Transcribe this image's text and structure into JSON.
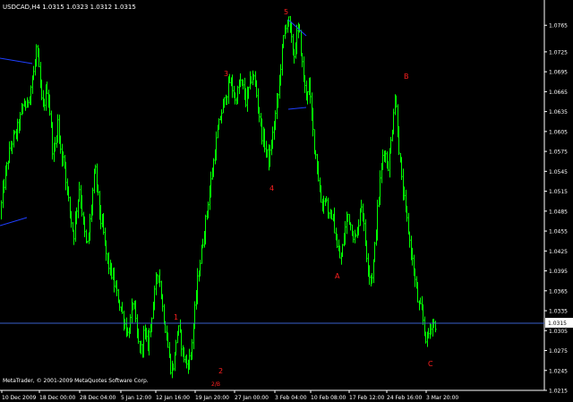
{
  "window": {
    "symbol_title": "USDCAD,H4  1.0315 1.0323 1.0312 1.0315",
    "copyright": "MetaTrader, © 2001-2009 MetaQuotes Software Corp."
  },
  "colors": {
    "background": "#000000",
    "candles": "#00ff00",
    "axis": "#ffffff",
    "annotations": "#ff0000",
    "trendlines": "#1f3fff",
    "price_line": "#3a5fcd",
    "current_price_box": "#ffffff"
  },
  "chart_data": {
    "type": "candlestick",
    "price_axis_ticks": [
      "1.0765",
      "1.0725",
      "1.0695",
      "1.0665",
      "1.0635",
      "1.0605",
      "1.0575",
      "1.0545",
      "1.0515",
      "1.0485",
      "1.0455",
      "1.0425",
      "1.0395",
      "1.0365",
      "1.0335",
      "1.0305",
      "1.0275",
      "1.0245",
      "1.0215"
    ],
    "time_axis_ticks": [
      "10 Dec 2009",
      "18 Dec 00:00",
      "28 Dec 04:00",
      "5 Jan 12:00",
      "12 Jan 16:00",
      "19 Jan 20:00",
      "27 Jan 00:00",
      "3 Feb 04:00",
      "10 Feb 08:00",
      "17 Feb 12:00",
      "24 Feb 16:00",
      "3 Mar 20:00"
    ],
    "current_price": "1.0315",
    "ylim": [
      1.0215,
      1.0795
    ],
    "wave_labels": [
      "1",
      "2",
      "2/B",
      "3",
      "4",
      "5",
      "A",
      "B",
      "C"
    ],
    "price_path": [
      [
        0,
        1.048
      ],
      [
        2,
        1.051
      ],
      [
        5,
        1.0535
      ],
      [
        8,
        1.056
      ],
      [
        11,
        1.058
      ],
      [
        14,
        1.0595
      ],
      [
        17,
        1.06
      ],
      [
        20,
        1.0615
      ],
      [
        23,
        1.063
      ],
      [
        26,
        1.065
      ],
      [
        29,
        1.064
      ],
      [
        32,
        1.066
      ],
      [
        35,
        1.068
      ],
      [
        38,
        1.07
      ],
      [
        40,
        1.073
      ],
      [
        42,
        1.071
      ],
      [
        44,
        1.068
      ],
      [
        46,
        1.065
      ],
      [
        48,
        1.064
      ],
      [
        50,
        1.066
      ],
      [
        52,
        1.067
      ],
      [
        54,
        1.065
      ],
      [
        56,
        1.062
      ],
      [
        58,
        1.058
      ],
      [
        60,
        1.057
      ],
      [
        62,
        1.06
      ],
      [
        64,
        1.062
      ],
      [
        66,
        1.059
      ],
      [
        68,
        1.056
      ],
      [
        70,
        1.057
      ],
      [
        72,
        1.055
      ],
      [
        74,
        1.052
      ],
      [
        76,
        1.05
      ],
      [
        78,
        1.048
      ],
      [
        80,
        1.046
      ],
      [
        82,
        1.045
      ],
      [
        84,
        1.048
      ],
      [
        86,
        1.05
      ],
      [
        88,
        1.052
      ],
      [
        90,
        1.05
      ],
      [
        92,
        1.047
      ],
      [
        94,
        1.045
      ],
      [
        96,
        1.043
      ],
      [
        98,
        1.044
      ],
      [
        100,
        1.047
      ],
      [
        102,
        1.05
      ],
      [
        104,
        1.053
      ],
      [
        106,
        1.0545
      ],
      [
        108,
        1.052
      ],
      [
        110,
        1.049
      ],
      [
        112,
        1.047
      ],
      [
        114,
        1.046
      ],
      [
        116,
        1.044
      ],
      [
        118,
        1.042
      ],
      [
        120,
        1.0405
      ],
      [
        122,
        1.04
      ],
      [
        124,
        1.039
      ],
      [
        126,
        1.038
      ],
      [
        128,
        1.037
      ],
      [
        130,
        1.036
      ],
      [
        132,
        1.035
      ],
      [
        134,
        1.034
      ],
      [
        136,
        1.033
      ],
      [
        138,
        1.032
      ],
      [
        140,
        1.031
      ],
      [
        142,
        1.03
      ],
      [
        144,
        1.031
      ],
      [
        146,
        1.033
      ],
      [
        148,
        1.035
      ],
      [
        150,
        1.033
      ],
      [
        152,
        1.03
      ],
      [
        154,
        1.0285
      ],
      [
        156,
        1.0275
      ],
      [
        158,
        1.028
      ],
      [
        160,
        1.03
      ],
      [
        162,
        1.0295
      ],
      [
        164,
        1.028
      ],
      [
        166,
        1.03
      ],
      [
        168,
        1.032
      ],
      [
        170,
        1.034
      ],
      [
        172,
        1.036
      ],
      [
        174,
        1.038
      ],
      [
        176,
        1.04
      ],
      [
        178,
        1.038
      ],
      [
        180,
        1.035
      ],
      [
        182,
        1.033
      ],
      [
        184,
        1.031
      ],
      [
        186,
        1.029
      ],
      [
        188,
        1.027
      ],
      [
        190,
        1.025
      ],
      [
        192,
        1.0245
      ],
      [
        194,
        1.026
      ],
      [
        196,
        1.029
      ],
      [
        198,
        1.031
      ],
      [
        200,
        1.03
      ],
      [
        202,
        1.0285
      ],
      [
        204,
        1.027
      ],
      [
        206,
        1.026
      ],
      [
        208,
        1.0255
      ],
      [
        210,
        1.026
      ],
      [
        212,
        1.0265
      ],
      [
        214,
        1.029
      ],
      [
        216,
        1.032
      ],
      [
        218,
        1.035
      ],
      [
        220,
        1.038
      ],
      [
        222,
        1.04
      ],
      [
        224,
        1.042
      ],
      [
        226,
        1.044
      ],
      [
        228,
        1.046
      ],
      [
        230,
        1.048
      ],
      [
        232,
        1.05
      ],
      [
        234,
        1.052
      ],
      [
        236,
        1.054
      ],
      [
        238,
        1.056
      ],
      [
        240,
        1.058
      ],
      [
        242,
        1.06
      ],
      [
        244,
        1.0615
      ],
      [
        246,
        1.063
      ],
      [
        248,
        1.064
      ],
      [
        250,
        1.065
      ],
      [
        252,
        1.066
      ],
      [
        254,
        1.067
      ],
      [
        256,
        1.068
      ],
      [
        258,
        1.0675
      ],
      [
        260,
        1.0665
      ],
      [
        262,
        1.065
      ],
      [
        264,
        1.066
      ],
      [
        266,
        1.067
      ],
      [
        268,
        1.068
      ],
      [
        270,
        1.0675
      ],
      [
        272,
        1.0665
      ],
      [
        274,
        1.065
      ],
      [
        276,
        1.066
      ],
      [
        278,
        1.0675
      ],
      [
        280,
        1.0685
      ],
      [
        282,
        1.069
      ],
      [
        284,
        1.068
      ],
      [
        286,
        1.066
      ],
      [
        288,
        1.064
      ],
      [
        290,
        1.062
      ],
      [
        292,
        1.06
      ],
      [
        294,
        1.059
      ],
      [
        296,
        1.058
      ],
      [
        298,
        1.057
      ],
      [
        300,
        1.056
      ],
      [
        302,
        1.058
      ],
      [
        304,
        1.06
      ],
      [
        306,
        1.062
      ],
      [
        308,
        1.064
      ],
      [
        310,
        1.066
      ],
      [
        312,
        1.069
      ],
      [
        314,
        1.072
      ],
      [
        316,
        1.0745
      ],
      [
        318,
        1.076
      ],
      [
        320,
        1.0775
      ],
      [
        322,
        1.077
      ],
      [
        324,
        1.075
      ],
      [
        326,
        1.073
      ],
      [
        328,
        1.072
      ],
      [
        330,
        1.074
      ],
      [
        332,
        1.076
      ],
      [
        334,
        1.075
      ],
      [
        336,
        1.072
      ],
      [
        338,
        1.069
      ],
      [
        340,
        1.067
      ],
      [
        342,
        1.066
      ],
      [
        344,
        1.068
      ],
      [
        346,
        1.065
      ],
      [
        348,
        1.062
      ],
      [
        350,
        1.059
      ],
      [
        352,
        1.057
      ],
      [
        354,
        1.055
      ],
      [
        356,
        1.052
      ],
      [
        358,
        1.05
      ],
      [
        360,
        1.049
      ],
      [
        362,
        1.051
      ],
      [
        364,
        1.05
      ],
      [
        366,
        1.048
      ],
      [
        368,
        1.047
      ],
      [
        370,
        1.048
      ],
      [
        372,
        1.047
      ],
      [
        374,
        1.045
      ],
      [
        376,
        1.043
      ],
      [
        378,
        1.042
      ],
      [
        380,
        1.041
      ],
      [
        382,
        1.043
      ],
      [
        384,
        1.045
      ],
      [
        386,
        1.047
      ],
      [
        388,
        1.048
      ],
      [
        390,
        1.047
      ],
      [
        392,
        1.046
      ],
      [
        394,
        1.045
      ],
      [
        396,
        1.044
      ],
      [
        398,
        1.045
      ],
      [
        400,
        1.047
      ],
      [
        402,
        1.05
      ],
      [
        404,
        1.049
      ],
      [
        406,
        1.046
      ],
      [
        408,
        1.043
      ],
      [
        410,
        1.041
      ],
      [
        412,
        1.039
      ],
      [
        414,
        1.038
      ],
      [
        416,
        1.04
      ],
      [
        418,
        1.043
      ],
      [
        420,
        1.047
      ],
      [
        422,
        1.05
      ],
      [
        424,
        1.053
      ],
      [
        426,
        1.056
      ],
      [
        428,
        1.058
      ],
      [
        430,
        1.057
      ],
      [
        432,
        1.055
      ],
      [
        434,
        1.056
      ],
      [
        436,
        1.059
      ],
      [
        438,
        1.062
      ],
      [
        440,
        1.066
      ],
      [
        442,
        1.064
      ],
      [
        444,
        1.06
      ],
      [
        446,
        1.056
      ],
      [
        448,
        1.053
      ],
      [
        450,
        1.051
      ],
      [
        452,
        1.049
      ],
      [
        454,
        1.047
      ],
      [
        456,
        1.045
      ],
      [
        458,
        1.043
      ],
      [
        460,
        1.041
      ],
      [
        462,
        1.039
      ],
      [
        464,
        1.037
      ],
      [
        466,
        1.035
      ],
      [
        468,
        1.034
      ],
      [
        470,
        1.0335
      ],
      [
        472,
        1.032
      ],
      [
        474,
        1.03
      ],
      [
        476,
        1.029
      ],
      [
        478,
        1.03
      ],
      [
        480,
        1.031
      ],
      [
        482,
        1.032
      ],
      [
        484,
        1.0315
      ],
      [
        486,
        1.0315
      ]
    ]
  }
}
